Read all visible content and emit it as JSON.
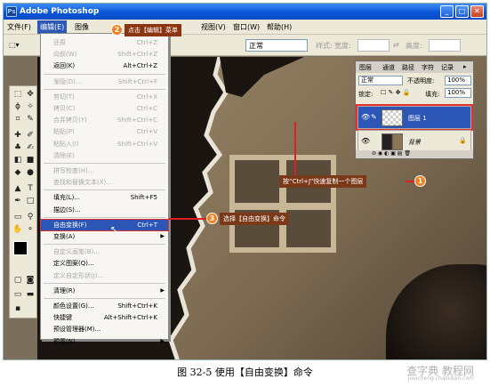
{
  "window": {
    "title": "Adobe Photoshop",
    "app_icon": "Ps"
  },
  "menubar": {
    "file": "文件(F)",
    "edit": "编辑(E)",
    "image": "图像",
    "view": "视图(V)",
    "window": "窗口(W)",
    "help": "帮助(H)"
  },
  "options": {
    "mode_value": "正常",
    "style_label": "样式:",
    "width_label": "宽度:",
    "height_label": "高度:"
  },
  "edit_menu": {
    "items": [
      {
        "label": "还原",
        "shortcut": "Ctrl+Z",
        "disabled": true
      },
      {
        "label": "向前(W)",
        "shortcut": "Shift+Ctrl+Z",
        "disabled": true
      },
      {
        "label": "返回(K)",
        "shortcut": "Alt+Ctrl+Z",
        "disabled": false
      },
      {
        "label": "渐隐(D)...",
        "shortcut": "Shift+Ctrl+F",
        "disabled": true
      },
      {
        "label": "剪切(T)",
        "shortcut": "Ctrl+X",
        "disabled": true
      },
      {
        "label": "拷贝(C)",
        "shortcut": "Ctrl+C",
        "disabled": true
      },
      {
        "label": "合并拷贝(Y)",
        "shortcut": "Shift+Ctrl+C",
        "disabled": true
      },
      {
        "label": "粘贴(P)",
        "shortcut": "Ctrl+V",
        "disabled": true
      },
      {
        "label": "粘贴入(I)",
        "shortcut": "Shift+Ctrl+V",
        "disabled": true
      },
      {
        "label": "清除(E)",
        "shortcut": "",
        "disabled": true
      },
      {
        "label": "拼写检查(H)...",
        "shortcut": "",
        "disabled": true
      },
      {
        "label": "查找和替换文本(X)...",
        "shortcut": "",
        "disabled": true
      },
      {
        "label": "填充(L)...",
        "shortcut": "Shift+F5",
        "disabled": false
      },
      {
        "label": "描边(S)...",
        "shortcut": "",
        "disabled": false
      },
      {
        "label": "自由变换(F)",
        "shortcut": "Ctrl+T",
        "disabled": false,
        "highlight": true
      },
      {
        "label": "变换(A)",
        "shortcut": "",
        "disabled": false,
        "submenu": true
      },
      {
        "label": "自定义画笔(B)...",
        "shortcut": "",
        "disabled": true
      },
      {
        "label": "定义图案(Q)...",
        "shortcut": "",
        "disabled": false
      },
      {
        "label": "定义自定形状(J)...",
        "shortcut": "",
        "disabled": true
      },
      {
        "label": "清理(R)",
        "shortcut": "",
        "disabled": false,
        "submenu": true
      },
      {
        "label": "颜色设置(G)...",
        "shortcut": "Shift+Ctrl+K",
        "disabled": false
      },
      {
        "label": "快捷键",
        "shortcut": "Alt+Shift+Ctrl+K",
        "disabled": false
      },
      {
        "label": "预设管理器(M)...",
        "shortcut": "",
        "disabled": false
      },
      {
        "label": "预置(N)",
        "shortcut": "",
        "disabled": false,
        "submenu": true
      }
    ]
  },
  "layers_panel": {
    "tabs": [
      "图层",
      "通道",
      "路径",
      "字符",
      "记录"
    ],
    "blend_mode": "正常",
    "opacity_label": "不透明度:",
    "opacity_value": "100%",
    "lock_label": "锁定:",
    "fill_label": "填充:",
    "fill_value": "100%",
    "layers": [
      {
        "name": "图层 1",
        "selected": true
      },
      {
        "name": "背景",
        "selected": false
      }
    ]
  },
  "annotations": {
    "step1_num": "1",
    "step1_text": "按“Ctrl+J”快速复制一个图层",
    "step2_num": "2",
    "step2_text": "点击【编辑】菜单",
    "step3_num": "3",
    "step3_text": "选择【自由变换】命令"
  },
  "caption": "图 32-5    使用【自由变换】命令",
  "watermark": {
    "text": "查字典 教程网",
    "url": "jiaocheng.chazidian.com"
  },
  "colors": {
    "accent_red": "#e02020",
    "step_orange": "#f08020",
    "highlight_blue": "#2b56b5"
  }
}
